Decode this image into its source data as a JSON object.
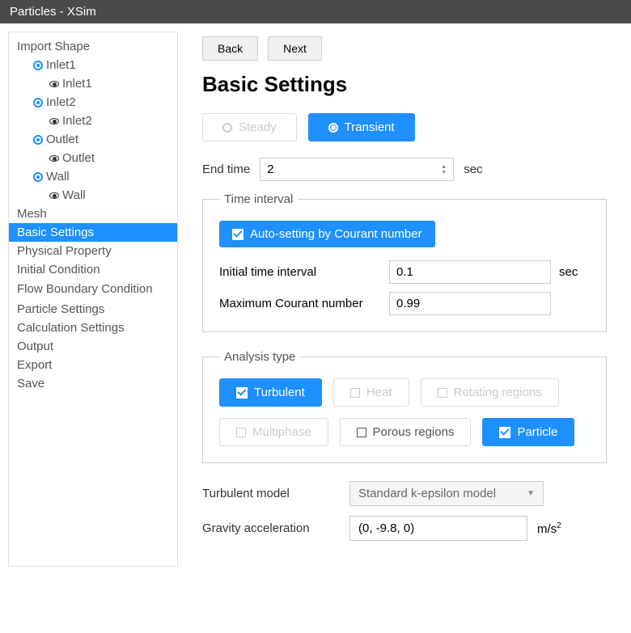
{
  "window_title": "Particles - XSim",
  "sidebar": {
    "import_shape": "Import Shape",
    "inlet1": "Inlet1",
    "inlet1_child": "Inlet1",
    "inlet2": "Inlet2",
    "inlet2_child": "Inlet2",
    "outlet": "Outlet",
    "outlet_child": "Outlet",
    "wall": "Wall",
    "wall_child": "Wall",
    "mesh": "Mesh",
    "basic_settings": "Basic Settings",
    "physical_property": "Physical Property",
    "initial_condition": "Initial Condition",
    "flow_boundary": "Flow Boundary Condition",
    "particle_settings": "Particle Settings",
    "calculation_settings": "Calculation Settings",
    "output": "Output",
    "export": "Export",
    "save": "Save"
  },
  "nav": {
    "back": "Back",
    "next": "Next"
  },
  "heading": "Basic Settings",
  "sim_mode": {
    "steady": "Steady",
    "transient": "Transient"
  },
  "end_time": {
    "label": "End time",
    "value": "2",
    "unit": "sec"
  },
  "time_interval": {
    "legend": "Time interval",
    "auto_label": "Auto-setting by Courant number",
    "initial_label": "Initial time interval",
    "initial_value": "0.1",
    "initial_unit": "sec",
    "courant_label": "Maximum Courant number",
    "courant_value": "0.99"
  },
  "analysis": {
    "legend": "Analysis type",
    "turbulent": "Turbulent",
    "heat": "Heat",
    "rotating": "Rotating regions",
    "multiphase": "Multiphase",
    "porous": "Porous regions",
    "particle": "Particle"
  },
  "turbulent_model": {
    "label": "Turbulent model",
    "value": "Standard k-epsilon model"
  },
  "gravity": {
    "label": "Gravity acceleration",
    "value": "(0, -9.8, 0)",
    "unit_base": "m/s",
    "unit_exp": "2"
  }
}
